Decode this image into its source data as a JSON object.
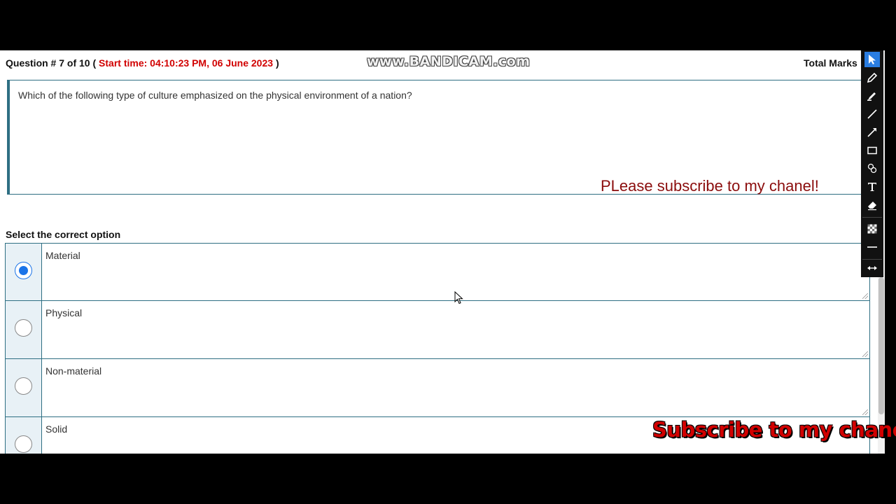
{
  "header": {
    "question_label": "Question # 7 of 10 (",
    "start_time": "Start time: 04:10:23 PM, 06 June 2023",
    "close_paren": ")",
    "total_marks": "Total Marks"
  },
  "watermark": "www.BANDICAM.com",
  "question": {
    "text": "Which of the following type of culture emphasized on the physical environment of a nation?",
    "overlay_note": "PLease subscribe to my chanel!"
  },
  "options_label": "Select the correct option",
  "options": [
    {
      "label": "Material",
      "selected": true
    },
    {
      "label": "Physical",
      "selected": false
    },
    {
      "label": "Non-material",
      "selected": false
    },
    {
      "label": "Solid",
      "selected": false
    }
  ],
  "toolbar": {
    "tools": [
      "cursor-arrow-icon",
      "pencil-icon",
      "highlighter-icon",
      "line-icon",
      "arrow-line-icon",
      "rectangle-icon",
      "numbering-icon",
      "text-icon",
      "eraser-icon",
      "checkerboard-icon",
      "minus-icon",
      "expand-arrows-icon"
    ]
  },
  "overlay_banner": "Subscribe to my chanel",
  "colors": {
    "accent_border": "#2e6f83",
    "start_time_red": "#d10000",
    "radio_selected": "#1a73e8",
    "option_cell_bg": "#e8f1f6"
  }
}
